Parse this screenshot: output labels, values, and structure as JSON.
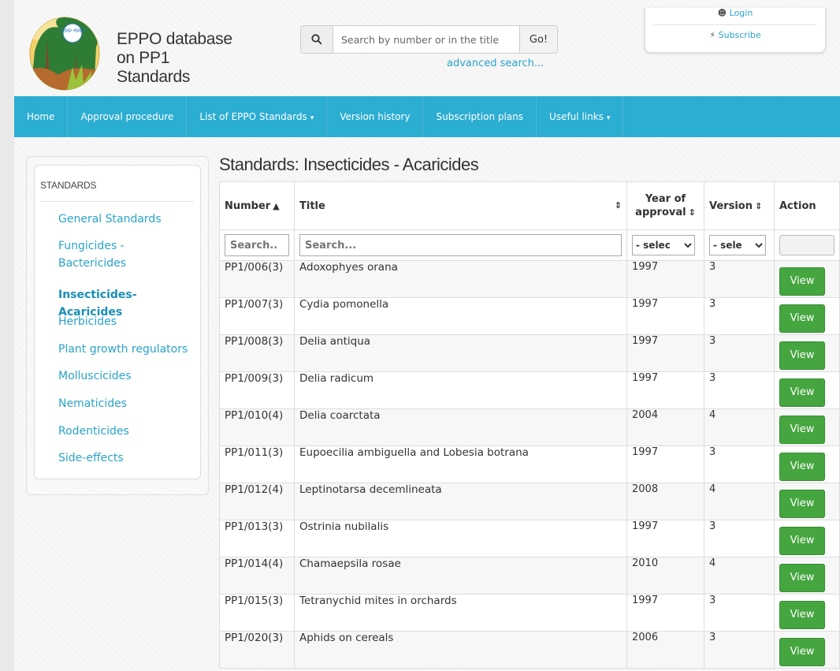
{
  "header": {
    "site_title": "EPPO database on PP1 Standards",
    "logo_text": "oepp eppo",
    "search_placeholder": "Search by number or in the title",
    "go_label": "Go!",
    "advanced_search": "advanced search...",
    "login": "Login",
    "subscribe": "Subscribe"
  },
  "nav": {
    "items": [
      {
        "label": "Home"
      },
      {
        "label": "Approval procedure"
      },
      {
        "label": "List of EPPO Standards",
        "caret": "▾"
      },
      {
        "label": "Version history"
      },
      {
        "label": "Subscription plans"
      },
      {
        "label": "Useful links",
        "caret": "▾"
      }
    ]
  },
  "sidebar": {
    "heading": "STANDARDS",
    "items": [
      {
        "label": "General Standards"
      },
      {
        "label": "Fungicides - Bactericides"
      },
      {
        "label": "Insecticides-Acaricides",
        "active": true
      },
      {
        "label": "Herbicides"
      },
      {
        "label": "Plant growth regulators"
      },
      {
        "label": "Molluscicides"
      },
      {
        "label": "Nematicides"
      },
      {
        "label": "Rodenticides"
      },
      {
        "label": "Side-effects"
      }
    ]
  },
  "main": {
    "title": "Standards: Insecticides - Acaricides",
    "columns": {
      "number": "Number",
      "title": "Title",
      "year": "Year of approval",
      "version": "Version",
      "action": "Action"
    },
    "filters": {
      "number_placeholder": "Search..",
      "title_placeholder": "Search...",
      "year_select": "- selec",
      "version_select": "- sele"
    },
    "view_label": "View",
    "rows": [
      {
        "number": "PP1/006(3)",
        "title": "Adoxophyes orana",
        "year": "1997",
        "version": "3"
      },
      {
        "number": "PP1/007(3)",
        "title": "Cydia pomonella",
        "year": "1997",
        "version": "3"
      },
      {
        "number": "PP1/008(3)",
        "title": "Delia antiqua",
        "year": "1997",
        "version": "3"
      },
      {
        "number": "PP1/009(3)",
        "title": "Delia radicum",
        "year": "1997",
        "version": "3"
      },
      {
        "number": "PP1/010(4)",
        "title": "Delia coarctata",
        "year": "2004",
        "version": "4"
      },
      {
        "number": "PP1/011(3)",
        "title": "Eupoecilia ambiguella and Lobesia botrana",
        "year": "1997",
        "version": "3"
      },
      {
        "number": "PP1/012(4)",
        "title": "Leptinotarsa decemlineata",
        "year": "2008",
        "version": "4"
      },
      {
        "number": "PP1/013(3)",
        "title": "Ostrinia nubilalis",
        "year": "1997",
        "version": "3"
      },
      {
        "number": "PP1/014(4)",
        "title": "Chamaepsila rosae",
        "year": "2010",
        "version": "4"
      },
      {
        "number": "PP1/015(3)",
        "title": "Tetranychid mites in orchards",
        "year": "1997",
        "version": "3"
      },
      {
        "number": "PP1/020(3)",
        "title": "Aphids on cereals",
        "year": "2006",
        "version": "3"
      }
    ]
  },
  "colors": {
    "accent": "#2cadd2",
    "link": "#2aa3c9",
    "button_green": "#45a53f"
  }
}
